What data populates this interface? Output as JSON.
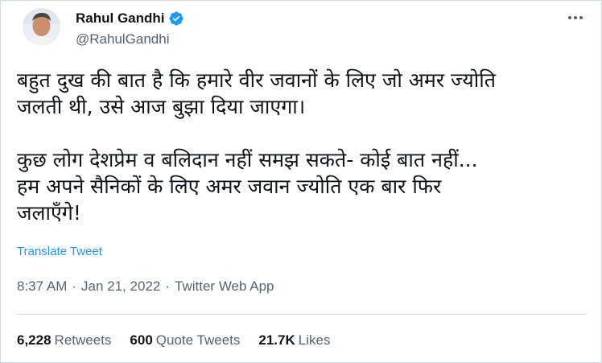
{
  "author": {
    "display_name": "Rahul Gandhi",
    "handle": "@RahulGandhi",
    "verified": true
  },
  "tweet": {
    "paragraphs": [
      [
        "बहुत दुख की बात है कि हमारे वीर जवानों के लिए जो अमर ज्योति",
        "जलती थी, उसे आज बुझा दिया जाएगा।"
      ],
      [
        "कुछ लोग देशप्रेम व बलिदान नहीं समझ सकते- कोई बात नहीं...",
        "हम अपने सैनिकों के लिए अमर जवान ज्योति एक बार फिर",
        "जलाएँगे!"
      ]
    ],
    "translate_label": "Translate Tweet",
    "time": "8:37 AM",
    "date": "Jan 21, 2022",
    "source": "Twitter Web App",
    "separator": "·"
  },
  "stats": {
    "retweets": {
      "count": "6,228",
      "label": "Retweets"
    },
    "quote_tweets": {
      "count": "600",
      "label": "Quote Tweets"
    },
    "likes": {
      "count": "21.7K",
      "label": "Likes"
    }
  },
  "colors": {
    "link": "#1d9bf0",
    "secondary_text": "#536471",
    "primary_text": "#0f1419",
    "divider": "#cfd9de"
  },
  "icons": {
    "verified": "verified-badge-icon",
    "more": "more-options-icon"
  }
}
